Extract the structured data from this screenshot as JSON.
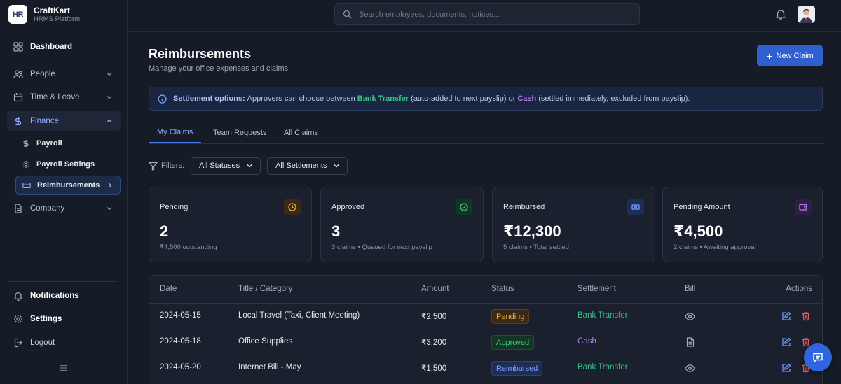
{
  "brand": {
    "logo_text": "HR",
    "name": "CraftKart",
    "sub": "HRMS Platform"
  },
  "sidebar": {
    "items": [
      {
        "label": "Dashboard",
        "icon": "dashboard-icon"
      },
      {
        "label": "People",
        "icon": "people-icon"
      },
      {
        "label": "Time & Leave",
        "icon": "calendar-icon"
      },
      {
        "label": "Finance",
        "icon": "dollar-icon"
      },
      {
        "label": "Company",
        "icon": "document-icon"
      }
    ],
    "finance_sub": [
      {
        "label": "Payroll",
        "icon": "dollar-icon"
      },
      {
        "label": "Payroll Settings",
        "icon": "gear-icon"
      },
      {
        "label": "Reimbursements",
        "icon": "card-icon"
      }
    ],
    "bottom": [
      {
        "label": "Notifications",
        "icon": "bell-icon"
      },
      {
        "label": "Settings",
        "icon": "gear-icon"
      },
      {
        "label": "Logout",
        "icon": "logout-icon"
      }
    ]
  },
  "search": {
    "placeholder": "Search employees, documents, notices..."
  },
  "page": {
    "title": "Reimbursements",
    "subtitle": "Manage your office expenses and claims",
    "new_claim": "New Claim"
  },
  "banner": {
    "lead": "Settlement options:",
    "text1": "Approvers can choose between",
    "bank": "Bank Transfer",
    "text2": "(auto-added to next payslip) or",
    "cash": "Cash",
    "text3": "(settled immediately, excluded from payslip)."
  },
  "tabs": [
    "My Claims",
    "Team Requests",
    "All Claims"
  ],
  "filters": {
    "label": "Filters:",
    "status": "All Statuses",
    "settlement": "All Settlements"
  },
  "cards": [
    {
      "label": "Pending",
      "value": "2",
      "note": "₹4,500 outstanding",
      "icon": "clock-icon",
      "color": "#f0a94a"
    },
    {
      "label": "Approved",
      "value": "3",
      "note": "3 claims • Queued for next payslip",
      "icon": "check-circle-icon",
      "color": "#3fc98a"
    },
    {
      "label": "Reimbursed",
      "value": "₹12,300",
      "note": "5 claims • Total settled",
      "icon": "banknote-icon",
      "color": "#7ea2ff"
    },
    {
      "label": "Pending Amount",
      "value": "₹4,500",
      "note": "2 claims • Awaiting approval",
      "icon": "wallet-icon",
      "color": "#b77cf2"
    }
  ],
  "table": {
    "headers": [
      "Date",
      "Title / Category",
      "Amount",
      "Status",
      "Settlement",
      "Bill",
      "Actions"
    ],
    "rows": [
      {
        "date": "2024-05-15",
        "title": "Local Travel (Taxi, Client Meeting)",
        "amount": "₹2,500",
        "status": "Pending",
        "settlement": "Bank Transfer",
        "bill": "eye-icon"
      },
      {
        "date": "2024-05-18",
        "title": "Office Supplies",
        "amount": "₹3,200",
        "status": "Approved",
        "settlement": "Cash",
        "bill": "file-icon"
      },
      {
        "date": "2024-05-20",
        "title": "Internet Bill - May",
        "amount": "₹1,500",
        "status": "Reimbursed",
        "settlement": "Bank Transfer",
        "bill": "eye-icon"
      }
    ]
  }
}
